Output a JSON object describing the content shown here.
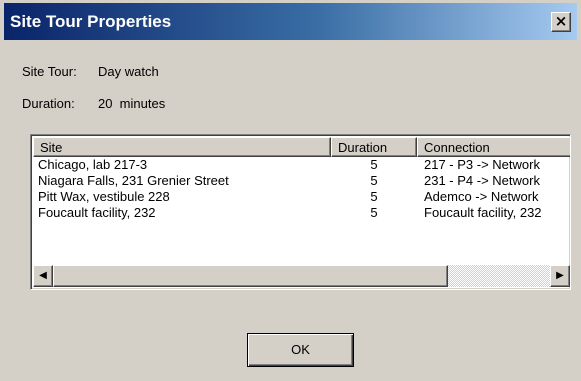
{
  "window": {
    "title": "Site Tour Properties",
    "close_glyph": "×"
  },
  "info": {
    "site_tour_label": "Site Tour:",
    "site_tour_value": "Day watch",
    "duration_label": "Duration:",
    "duration_value": "20  minutes"
  },
  "table": {
    "columns": [
      "Site",
      "Duration",
      "Connection"
    ],
    "rows": [
      {
        "site": "Chicago, lab 217-3",
        "duration": "5",
        "connection": "217 - P3 -> Network"
      },
      {
        "site": "Niagara Falls, 231 Grenier Street",
        "duration": "5",
        "connection": "231 - P4 -> Network"
      },
      {
        "site": "Pitt Wax, vestibule 228",
        "duration": "5",
        "connection": "Ademco -> Network"
      },
      {
        "site": "Foucault facility, 232",
        "duration": "5",
        "connection": "Foucault facility, 232"
      }
    ]
  },
  "scrollbar": {
    "left_arrow": "◀",
    "right_arrow": "▶"
  },
  "buttons": {
    "ok_label": "OK"
  },
  "colors": {
    "titlebar_start": "#0a246a",
    "titlebar_end": "#a6caf0",
    "dialog_bg": "#d4d0c8"
  }
}
